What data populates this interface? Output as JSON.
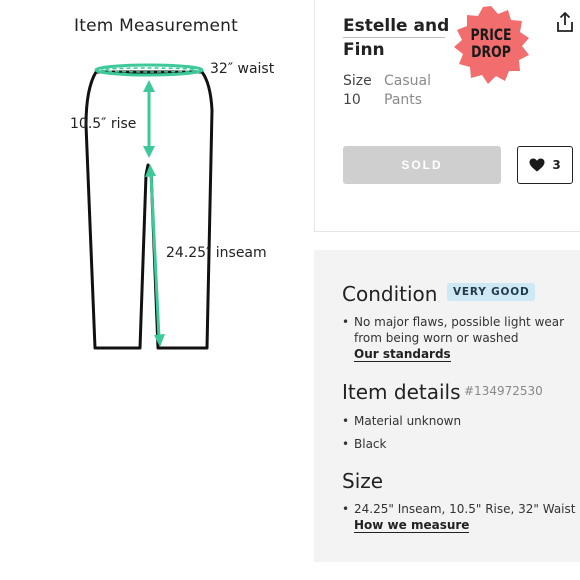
{
  "diagram": {
    "title": "Item Measurement",
    "waist_label": "32″ waist",
    "rise_label": "10.5″ rise",
    "inseam_label": "24.25″ inseam",
    "accent_color": "#3ec99a"
  },
  "listing": {
    "brand": "Estelle and Finn",
    "size_label": "Size",
    "size_value": "10",
    "category_line1": "Casual",
    "category_line2": "Pants",
    "badge_line1": "PRICE",
    "badge_line2": "DROP",
    "badge_color": "#f26d6d",
    "sold_label": "SOLD",
    "like_count": "3",
    "share_icon": "share-icon",
    "heart_icon": "heart-icon"
  },
  "details": {
    "condition_title": "Condition",
    "condition_badge": "VERY GOOD",
    "condition_bullet": "No major flaws, possible light wear from being worn or washed",
    "condition_link": "Our standards",
    "item_details_title": "Item details",
    "item_id": "#134972530",
    "material": "Material unknown",
    "color": "Black",
    "size_title": "Size",
    "size_bullet": "24.25\" Inseam, 10.5\" Rise, 32\" Waist",
    "measure_link": "How we measure"
  }
}
